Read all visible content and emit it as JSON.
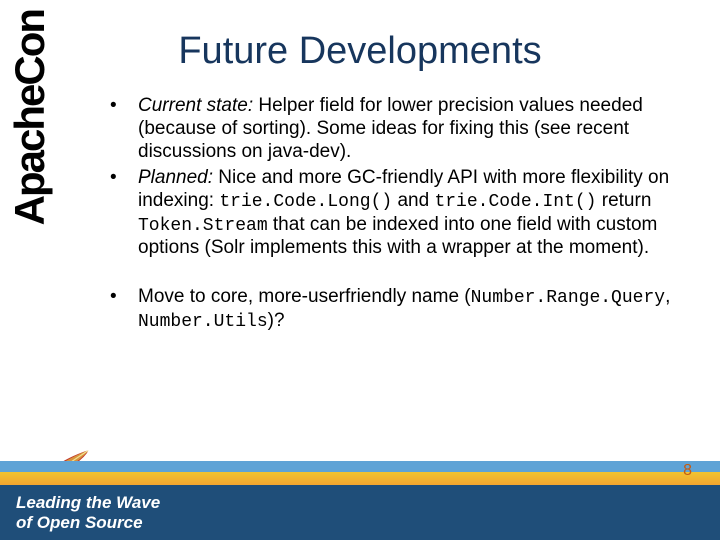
{
  "brand": {
    "vertical_logo": "ApacheCon",
    "feather_alt": "feather-logo"
  },
  "slide": {
    "title": "Future Developments",
    "page_number": "8"
  },
  "bullets": [
    {
      "label": "Current state:",
      "text_before": " Helper field for lower precision values needed (because of sorting). Some ideas for fixing this (see recent discussions on java-dev)."
    },
    {
      "label": "Planned:",
      "text_before": " Nice and more GC-friendly API with more flexibility on indexing: ",
      "code1": "trie.Code.Long()",
      "mid1": " and ",
      "code2": "trie.Code.Int()",
      "mid2": " return ",
      "code3": "Token.Stream",
      "tail": " that can be indexed into one field with custom options (Solr implements this with a wrapper at the moment)."
    },
    {
      "text_before": "Move to core, more-userfriendly name (",
      "code1": "Number.Range.Query",
      "mid1": ", ",
      "code2": "Number.Utils",
      "tail": ")?"
    }
  ],
  "footer": {
    "tagline_line1": "Leading the Wave",
    "tagline_line2": "of Open Source"
  }
}
